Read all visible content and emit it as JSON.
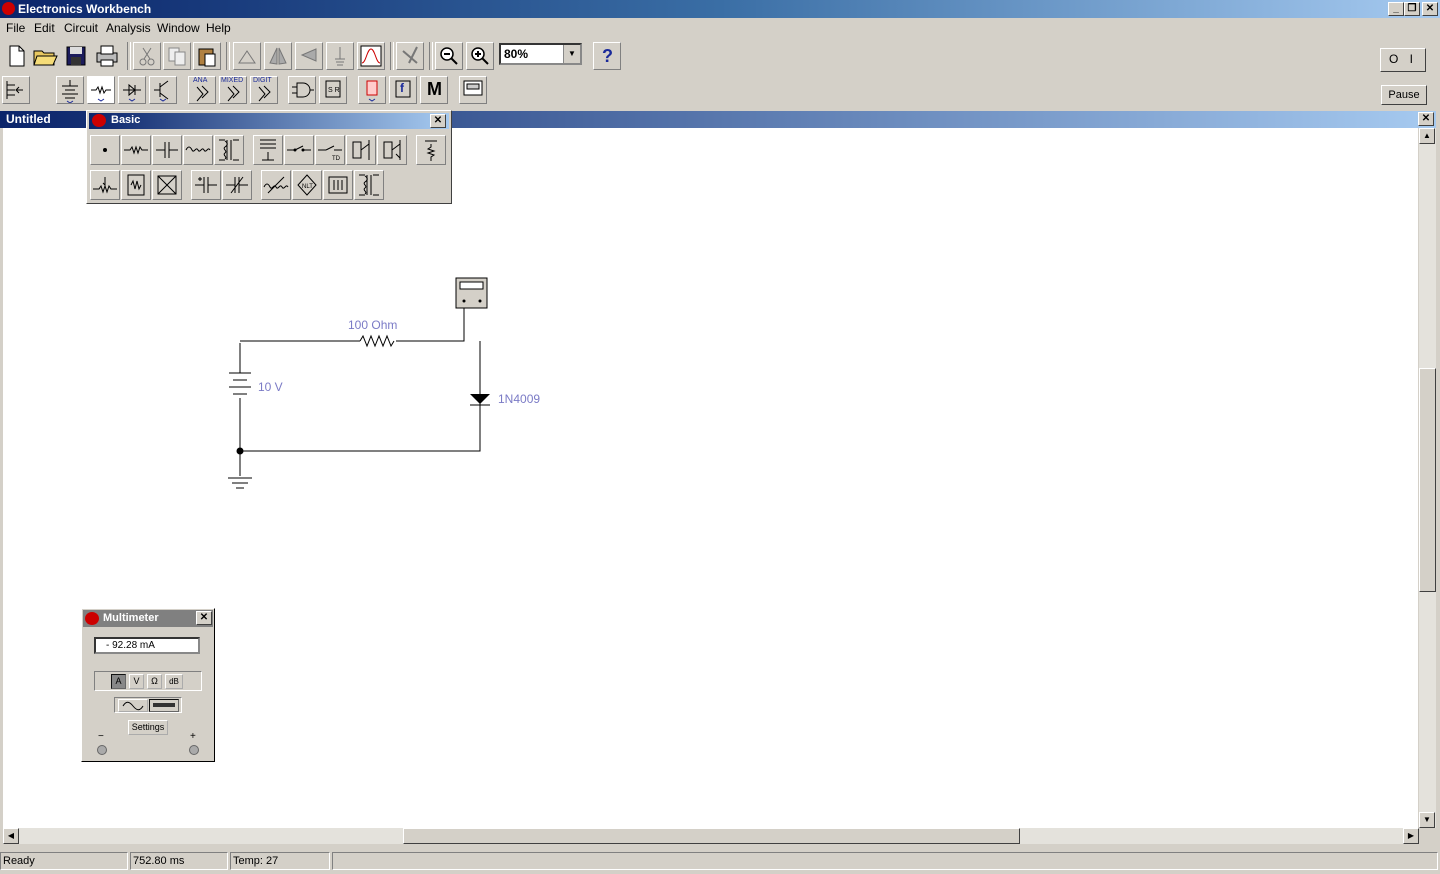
{
  "app": {
    "title": "Electronics Workbench"
  },
  "menu": [
    "File",
    "Edit",
    "Circuit",
    "Analysis",
    "Window",
    "Help"
  ],
  "toolbar": {
    "zoom_value": "80%",
    "help_glyph": "?",
    "pause_label": "Pause",
    "power_label": "O I"
  },
  "parts_bin": {
    "labels": [
      "ANA",
      "MIXED",
      "DIGIT"
    ],
    "misc_glyph": "M",
    "func_glyph": "f"
  },
  "document": {
    "title": "Untitled"
  },
  "palette": {
    "title": "Basic"
  },
  "circuit": {
    "resistor_label": "100  Ohm",
    "battery_label": "10 V",
    "diode_label": "1N4009"
  },
  "multimeter": {
    "title": "Multimeter",
    "display": "- 92.28   mA",
    "modes": [
      "A",
      "V",
      "Ω",
      "dB"
    ],
    "settings_label": "Settings",
    "neg_label": "−",
    "pos_label": "+"
  },
  "status": {
    "ready": "Ready",
    "time": "752.80 ms",
    "temp": "Temp:  27"
  },
  "colors": {
    "title_start": "#0a246a",
    "title_end": "#a6caf0",
    "label_color": "#7b7bc6"
  }
}
